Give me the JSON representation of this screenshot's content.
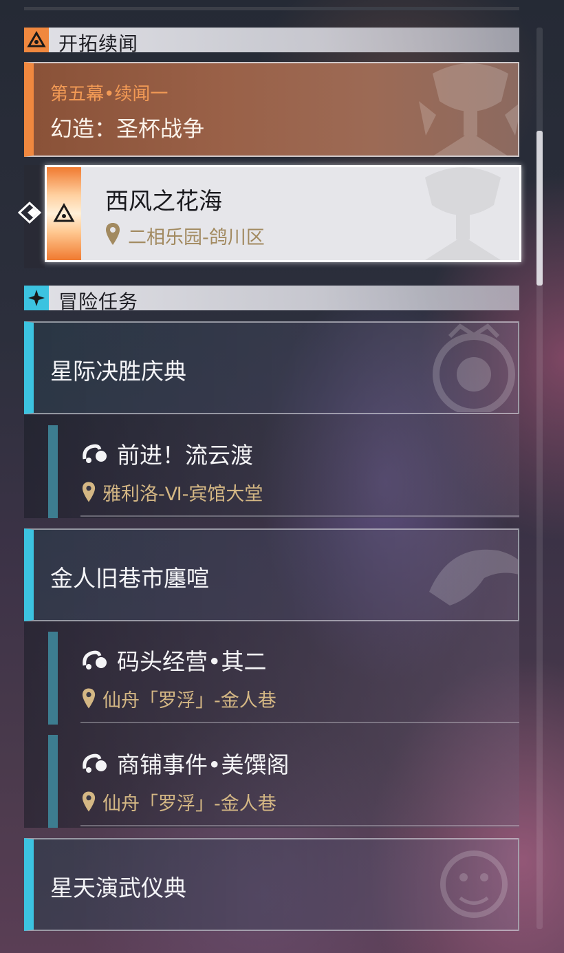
{
  "sections": {
    "trailblaze": {
      "title": "开拓续闻"
    },
    "adventure": {
      "title": "冒险任务"
    }
  },
  "trailblaze_card": {
    "chapter": "第五幕•续闻一",
    "title": "幻造：圣杯战争"
  },
  "active_quest": {
    "title": "西风之花海",
    "location": "二相乐园-鸽川区"
  },
  "adventure_groups": [
    {
      "title": "星际决胜庆典",
      "items": [
        {
          "title": "前进！流云渡",
          "location": "雅利洛-Ⅵ-宾馆大堂"
        }
      ]
    },
    {
      "title": "金人旧巷市廛喧",
      "items": [
        {
          "title": "码头经营•其二",
          "location": "仙舟「罗浮」-金人巷"
        },
        {
          "title": "商铺事件•美馔阁",
          "location": "仙舟「罗浮」-金人巷"
        }
      ]
    },
    {
      "title": "星天演武仪典",
      "items": []
    }
  ],
  "colors": {
    "trailblaze_accent": "#f0883f",
    "adventure_accent": "#3cc3e0",
    "location_text": "#d4b784"
  }
}
